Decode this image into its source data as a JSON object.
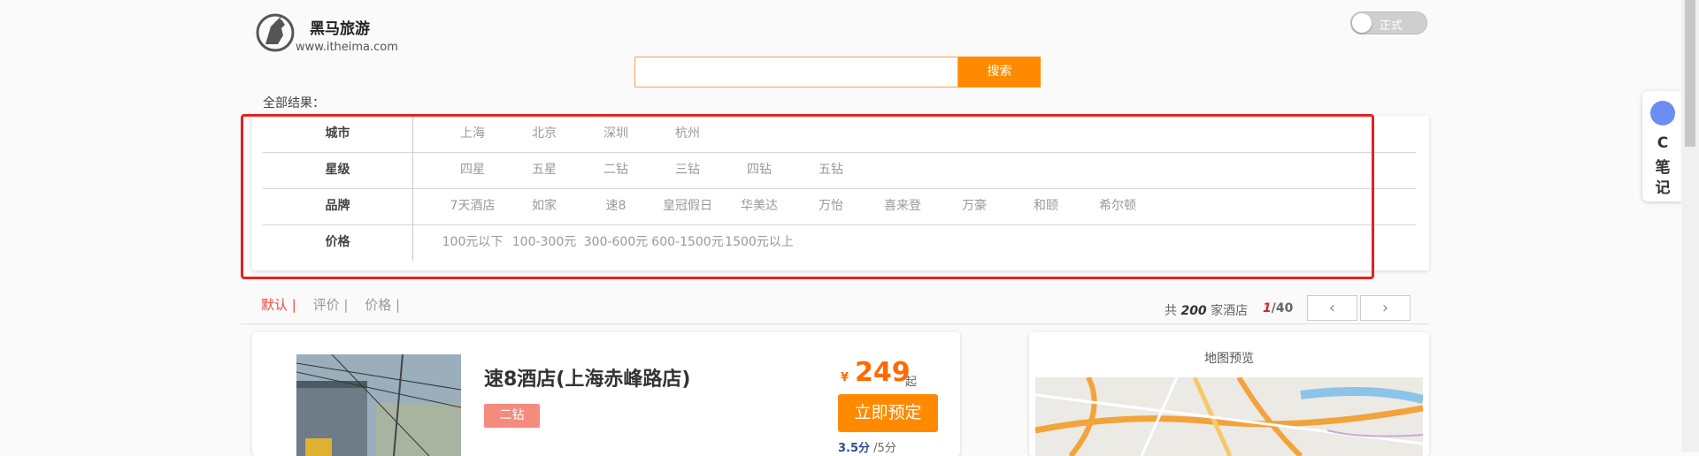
{
  "header": {
    "site_name": "黑马旅游",
    "site_url": "www.itheima.com",
    "mode_toggle_label": "正式"
  },
  "search": {
    "placeholder": "",
    "button_label": "搜索"
  },
  "results_label": "全部结果：",
  "filters": {
    "rows": [
      {
        "label": "城市",
        "options": [
          "上海",
          "北京",
          "深圳",
          "杭州"
        ]
      },
      {
        "label": "星级",
        "options": [
          "四星",
          "五星",
          "二钻",
          "三钻",
          "四钻",
          "五钻"
        ]
      },
      {
        "label": "品牌",
        "options": [
          "7天酒店",
          "如家",
          "速8",
          "皇冠假日",
          "华美达",
          "万怡",
          "喜来登",
          "万豪",
          "和颐",
          "希尔顿"
        ]
      },
      {
        "label": "价格",
        "options": [
          "100元以下",
          "100-300元",
          "300-600元",
          "600-1500元",
          "1500元以上"
        ]
      }
    ]
  },
  "sort": {
    "items": [
      "默认 |",
      "评价 |",
      "价格 |"
    ],
    "active_index": 0
  },
  "pagination": {
    "total_prefix": "共",
    "total_count": "200",
    "total_suffix": "家酒店",
    "current_page": "1",
    "total_pages": "/40",
    "prev_icon": "‹",
    "next_icon": "›"
  },
  "hotel": {
    "name": "速8酒店(上海赤峰路店)",
    "star": "二钻",
    "price_symbol": "¥",
    "price": "249",
    "price_suffix": "起",
    "book_label": "立即预定",
    "rating_score": "3.5分",
    "rating_max": "/5分"
  },
  "map": {
    "title": "地图预览"
  },
  "side_note": {
    "line1": "C",
    "line2": "笔",
    "line3": "记"
  },
  "colors": {
    "accent": "#ff8a00",
    "highlight": "#e62020",
    "star_badge": "#f58b7e"
  }
}
